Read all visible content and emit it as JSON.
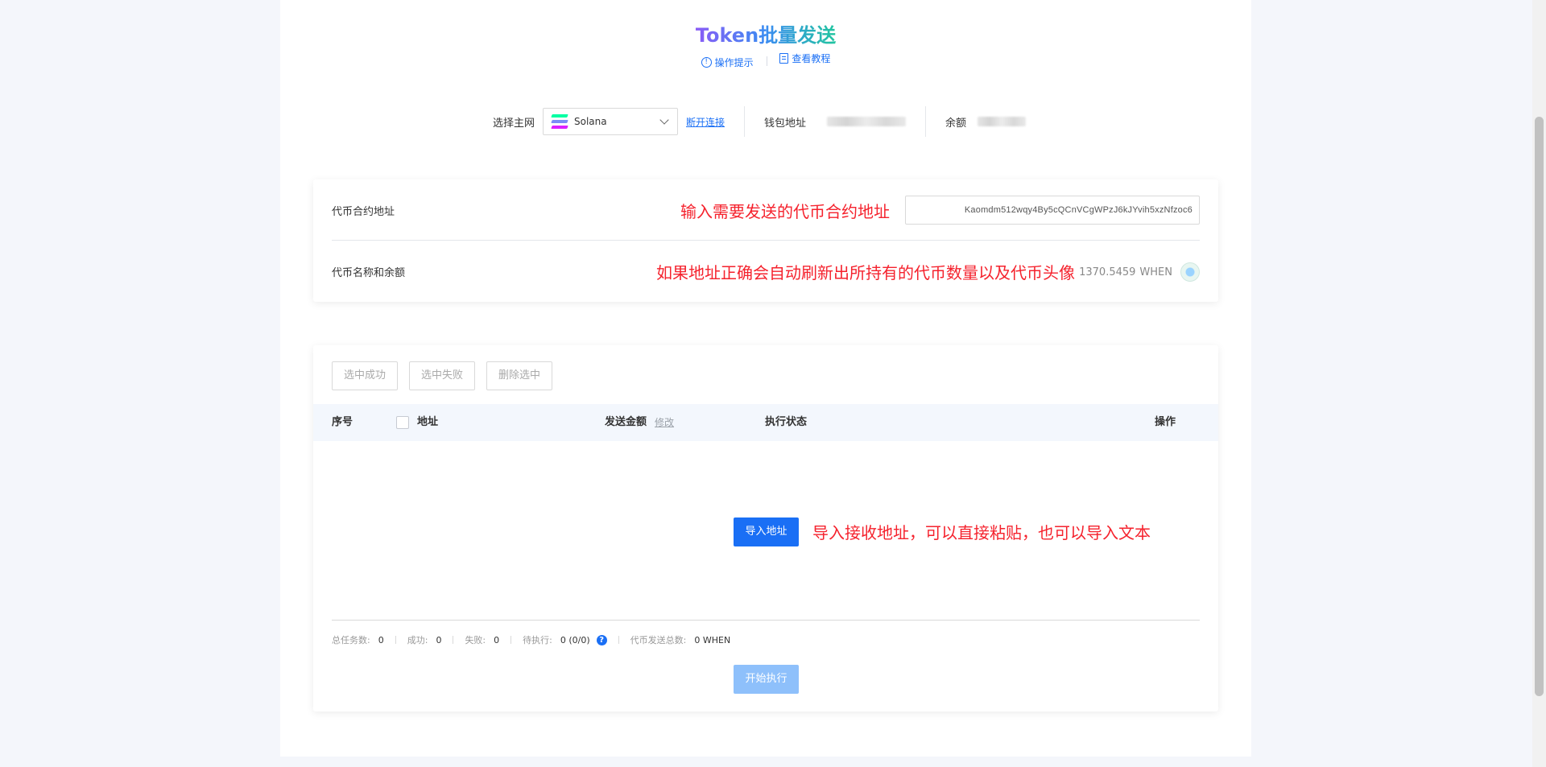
{
  "header": {
    "title": "Token批量发送",
    "links": [
      {
        "label": "操作提示"
      },
      {
        "label": "查看教程"
      }
    ]
  },
  "network": {
    "select_label": "选择主网",
    "selected": "Solana",
    "disconnect": "断开连接",
    "wallet_label": "钱包地址",
    "balance_label": "余额"
  },
  "token_card": {
    "contract_label": "代币合约地址",
    "contract_hint": "输入需要发送的代币合约地址",
    "contract_value": "Kaomdm512wqy4By5cQCnVCgWPzJ6kJYvih5xzNfzoc6",
    "name_label": "代币名称和余额",
    "name_hint": "如果地址正确会自动刷新出所持有的代币数量以及代币头像",
    "balance_amount": "1370.5459",
    "balance_symbol": "WHEN"
  },
  "task_card": {
    "buttons": [
      "选中成功",
      "选中失败",
      "删除选中"
    ],
    "columns": {
      "index": "序号",
      "address": "地址",
      "amount": "发送金额",
      "edit": "修改",
      "status": "执行状态",
      "action": "操作"
    },
    "import_button": "导入地址",
    "import_hint": "导入接收地址，可以直接粘贴，也可以导入文本",
    "stats": {
      "total_label": "总任务数:",
      "total": "0",
      "success_label": "成功:",
      "success": "0",
      "fail_label": "失败:",
      "fail": "0",
      "pending_label": "待执行:",
      "pending": "0 (0/0)",
      "sent_label": "代币发送总数:",
      "sent": "0 WHEN"
    },
    "start_button": "开始执行"
  },
  "colors": {
    "primary": "#1a6ff5",
    "annotation": "#f5222d",
    "disabled": "#8ec0fb"
  }
}
